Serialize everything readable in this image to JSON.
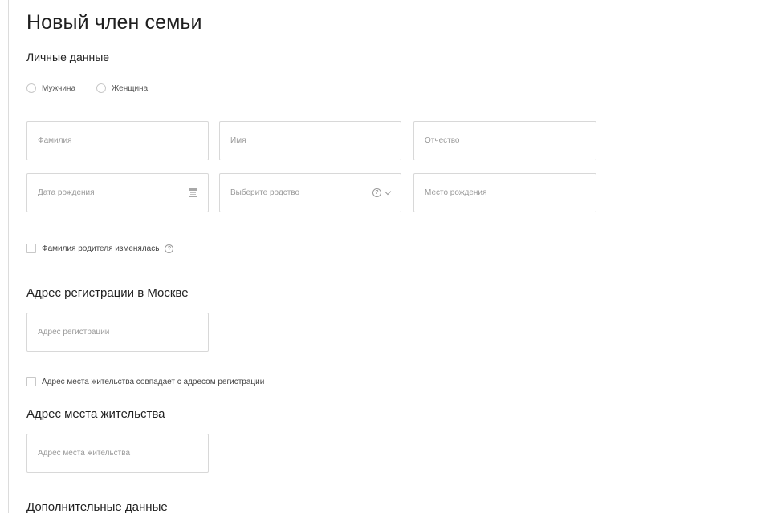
{
  "page": {
    "title": "Новый член семьи"
  },
  "personal": {
    "heading": "Личные данные",
    "gender": {
      "male": "Мужчина",
      "female": "Женщина"
    },
    "fields": {
      "last_name_placeholder": "Фамилия",
      "first_name_placeholder": "Имя",
      "middle_name_placeholder": "Отчество",
      "birth_date_placeholder": "Дата рождения",
      "relation_placeholder": "Выберите родство",
      "birth_place_placeholder": "Место рождения"
    },
    "parent_surname_changed_label": "Фамилия родителя изменялась"
  },
  "registration": {
    "heading": "Адрес регистрации в Москве",
    "address_placeholder": "Адрес регистрации",
    "same_as_registration_label": "Адрес места жительства совпадает с адресом регистрации"
  },
  "residence": {
    "heading": "Адрес места жительства",
    "address_placeholder": "Адрес места жительства"
  },
  "additional": {
    "heading": "Дополнительные данные"
  },
  "icons": {
    "calendar": "calendar-icon",
    "help": "help-icon",
    "chevron": "chevron-down-icon",
    "help_glyph": "?"
  },
  "colors": {
    "border": "#d8d8d8",
    "placeholder": "#9a9a9a",
    "text": "#222222"
  }
}
